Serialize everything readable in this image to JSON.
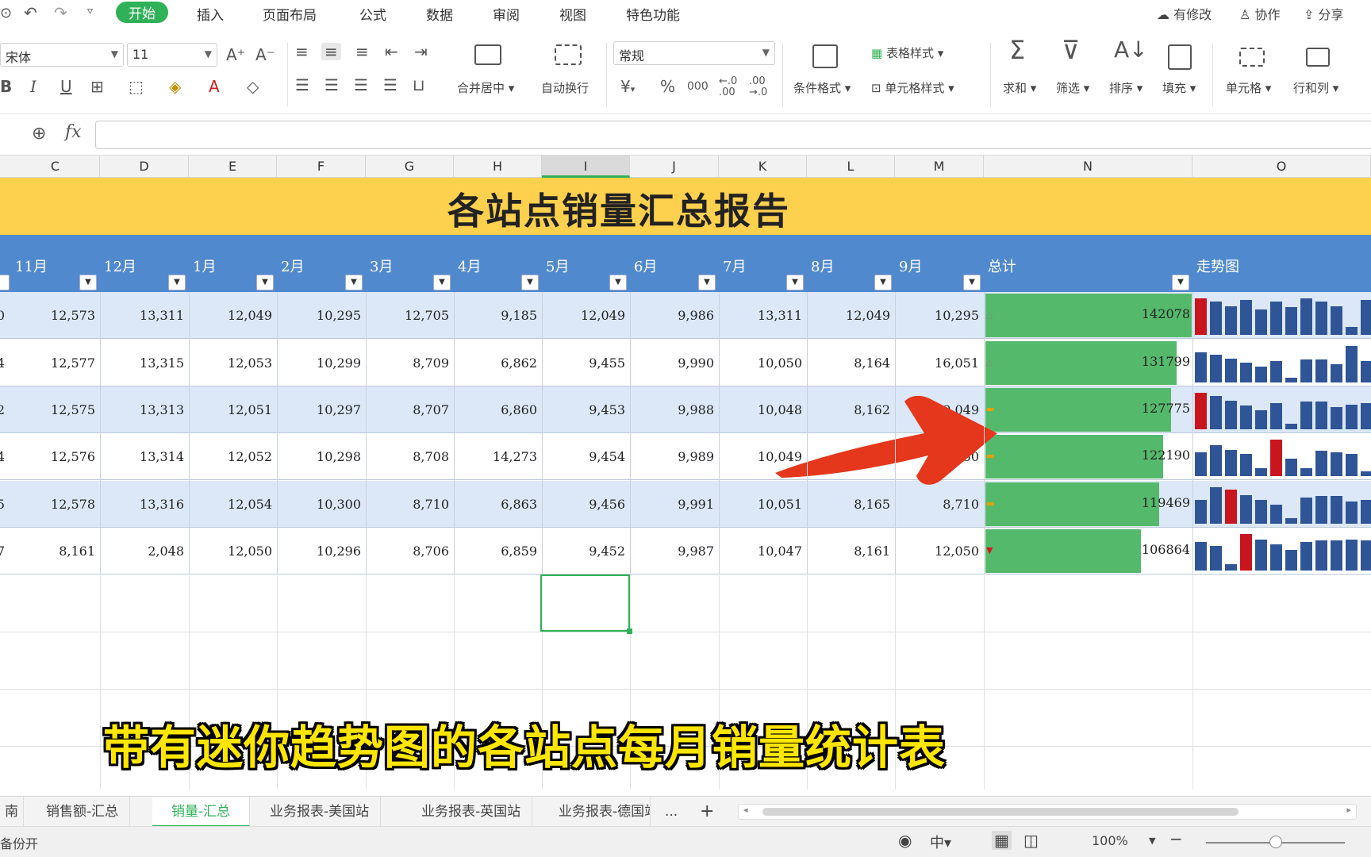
{
  "menubar": {
    "items": [
      "开始",
      "插入",
      "页面布局",
      "公式",
      "数据",
      "审阅",
      "视图",
      "特色功能"
    ],
    "right": [
      "有修改",
      "协作",
      "分享"
    ]
  },
  "ribbon": {
    "font_name": "宋体",
    "font_size": "11",
    "number_format": "常规",
    "merge_label": "合并居中",
    "wrap_label": "自动换行",
    "cond_format_label": "条件格式",
    "table_style_label": "表格样式",
    "cell_style_label": "单元格样式",
    "sum_label": "求和",
    "filter_label": "筛选",
    "sort_label": "排序",
    "fill_label": "填充",
    "cell_label": "单元格",
    "rowcol_label": "行和列",
    "currency_symbol": "¥",
    "percent_symbol": "%",
    "thousands_symbol": "000"
  },
  "formula_bar": {
    "fx": "fx",
    "value": ""
  },
  "columns": [
    "C",
    "D",
    "E",
    "F",
    "G",
    "H",
    "I",
    "J",
    "K",
    "L",
    "M",
    "N",
    "O"
  ],
  "selected_column": "I",
  "sheet": {
    "title": "各站点销量汇总报告",
    "headers": [
      "11月",
      "12月",
      "1月",
      "2月",
      "3月",
      "4月",
      "5月",
      "6月",
      "7月",
      "8月",
      "9月",
      "总计",
      "走势图"
    ],
    "rows": [
      {
        "prefix": "0",
        "values": [
          "12,573",
          "13,311",
          "12,049",
          "10,295",
          "12,705",
          "9,185",
          "12,049",
          "9,986",
          "13,311",
          "12,049",
          "10,295"
        ],
        "total": "142078",
        "total_value": 142078,
        "indicator": "up",
        "spark": [
          13311,
          12049,
          10295,
          12705,
          9185,
          12049,
          9986,
          13311,
          12049,
          10295,
          3000,
          12705
        ],
        "spark_red": [
          0
        ]
      },
      {
        "prefix": "4",
        "values": [
          "12,577",
          "13,315",
          "12,053",
          "10,299",
          "8,709",
          "6,862",
          "9,455",
          "9,990",
          "10,050",
          "8,164",
          "16,051"
        ],
        "total": "131799",
        "total_value": 131799,
        "indicator": "up",
        "spark": [
          13315,
          12053,
          10299,
          8709,
          6862,
          9455,
          2000,
          9990,
          10050,
          8164,
          16051,
          9455
        ],
        "spark_red": []
      },
      {
        "prefix": "2",
        "values": [
          "12,575",
          "13,313",
          "12,051",
          "10,297",
          "8,707",
          "6,860",
          "9,453",
          "9,988",
          "10,048",
          "8,162",
          "9,049"
        ],
        "total": "127775",
        "total_value": 127775,
        "indicator": "flat",
        "spark": [
          13313,
          12051,
          10297,
          8707,
          6860,
          9453,
          2000,
          9988,
          10048,
          8162,
          9049,
          9453
        ],
        "spark_red": [
          0
        ]
      },
      {
        "prefix": "4",
        "values": [
          "12,576",
          "13,314",
          "12,052",
          "10,298",
          "8,708",
          "14,273",
          "9,454",
          "9,989",
          "10,049",
          "8,163",
          "9,050"
        ],
        "total": "122190",
        "total_value": 122190,
        "indicator": "flat",
        "spark": [
          9454,
          12052,
          10298,
          8708,
          3000,
          14273,
          6860,
          3000,
          9989,
          9454,
          8708,
          2000
        ],
        "spark_red": [
          5
        ]
      },
      {
        "prefix": "5",
        "values": [
          "12,578",
          "13,316",
          "12,054",
          "10,300",
          "8,710",
          "6,863",
          "9,456",
          "9,991",
          "10,051",
          "8,165",
          "8,710"
        ],
        "total": "119469",
        "total_value": 119469,
        "indicator": "flat",
        "spark": [
          8710,
          13316,
          12578,
          10300,
          8710,
          6863,
          2000,
          9456,
          9991,
          10051,
          8165,
          8710
        ],
        "spark_red": [
          2
        ]
      },
      {
        "prefix": "7",
        "values": [
          "8,161",
          "2,048",
          "12,050",
          "10,296",
          "8,706",
          "6,859",
          "9,452",
          "9,987",
          "10,047",
          "8,161",
          "12,050"
        ],
        "total": "106864",
        "total_value": 106864,
        "indicator": "down",
        "spark": [
          9452,
          8161,
          2048,
          12050,
          10296,
          8706,
          6859,
          9452,
          9987,
          10047,
          10296,
          10047
        ],
        "spark_red": [
          3
        ]
      }
    ]
  },
  "caption": "带有迷你趋势图的各站点每月销量统计表",
  "tabs": [
    "南",
    "销售额-汇总",
    "销量-汇总",
    "业务报表-美国站",
    "业务报表-英国站",
    "业务报表-德国站",
    "...",
    "+"
  ],
  "active_tab": "销量-汇总",
  "status": {
    "left": "备份开",
    "zoom": "100%"
  },
  "colors": {
    "accent": "#2fb157",
    "header_blue": "#5089ce",
    "title_yellow": "#fdd04d",
    "bar_green": "#55b96b",
    "spark_blue": "#2f5597",
    "spark_red": "#c9151e",
    "arrow_red": "#e4371b"
  }
}
